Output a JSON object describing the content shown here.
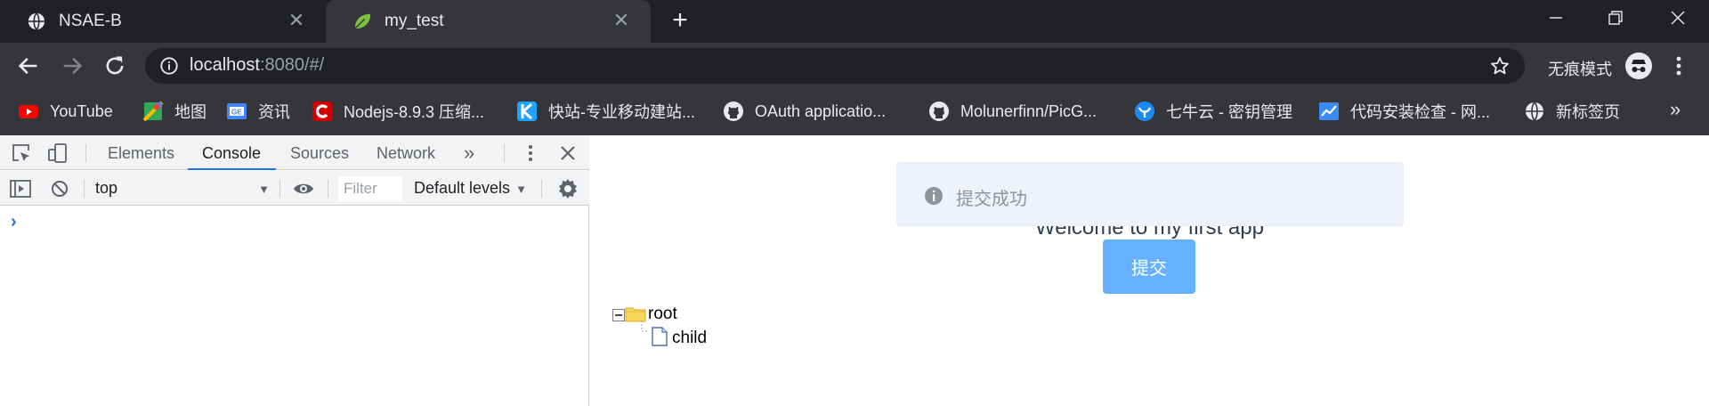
{
  "browser": {
    "tabs": [
      {
        "title": "NSAE-B",
        "favicon": "globe-icon",
        "active": false
      },
      {
        "title": "my_test",
        "favicon": "leaf-icon",
        "active": true
      }
    ],
    "new_tab_icon": "plus-icon",
    "window_controls": [
      "minimize-icon",
      "restore-icon",
      "close-icon"
    ]
  },
  "toolbar": {
    "url_host": "localhost",
    "url_rest": ":8080/#/",
    "incognito_label": "无痕模式",
    "incognito_icon": "incognito-icon"
  },
  "bookmarks": [
    {
      "label": "YouTube",
      "icon": "youtube-icon"
    },
    {
      "label": "地图",
      "icon": "maps-icon"
    },
    {
      "label": "资讯",
      "icon": "news-icon"
    },
    {
      "label": "Nodejs-8.9.3 压缩...",
      "icon": "c-logo-icon"
    },
    {
      "label": "快站-专业移动建站...",
      "icon": "kuaizhan-icon"
    },
    {
      "label": "OAuth applicatio...",
      "icon": "github-icon"
    },
    {
      "label": "Molunerfinn/PicG...",
      "icon": "github-icon"
    },
    {
      "label": "七牛云 - 密钥管理",
      "icon": "qiniu-icon"
    },
    {
      "label": "代码安装检查 - 网...",
      "icon": "chart-icon"
    },
    {
      "label": "新标签页",
      "icon": "globe-icon"
    }
  ],
  "devtools": {
    "tabs": [
      "Elements",
      "Console",
      "Sources",
      "Network"
    ],
    "active_tab": "Console",
    "context": "top",
    "filter_placeholder": "Filter",
    "levels": "Default levels",
    "prompt": "›"
  },
  "page": {
    "welcome": "Welcome to my first app",
    "toast_message": "提交成功",
    "submit_label": "提交",
    "tree": {
      "root": "root",
      "child": "child"
    }
  },
  "colors": {
    "tab_strip": "#202124",
    "toolbar": "#35363a",
    "accent": "#1a73e8",
    "button": "#66b1ff",
    "toast_bg": "#edf2fc"
  }
}
